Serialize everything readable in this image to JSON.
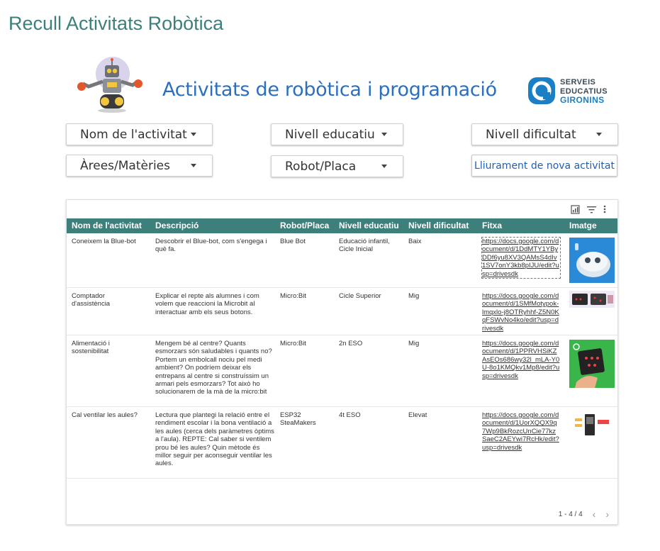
{
  "page": {
    "title": "Recull Activitats Robòtica"
  },
  "banner": {
    "title": "Activitats de robòtica i programació",
    "org_logo": {
      "line1": "SERVEIS",
      "line2": "EDUCATIUS",
      "line3": "GIRONINS",
      "color": "#1a7fc4"
    }
  },
  "filters": {
    "activity_name": "Nom de l'activitat",
    "educational_level": "Nivell educatiu",
    "difficulty_level": "Nivell dificultat",
    "subject_areas": "Àrees/Matèries",
    "robot_board": "Robot/Placa",
    "new_activity_button": "Lliurament de nova activitat"
  },
  "table": {
    "header_color": "#3d7f7a",
    "columns": [
      "Nom de l'activitat",
      "Descripció",
      "Robot/Placa",
      "Nivell educatiu",
      "Nivell dificultat",
      "Fitxa",
      "Imatge"
    ],
    "rows": [
      {
        "name": "Coneixem la Blue-bot",
        "description": "Descobrir el Blue-bot, com s'engega i què fa.",
        "robot": "Blue Bot",
        "level": "Educació infantil, Cicle Inicial",
        "difficulty": "Baix",
        "link": "https://docs.google.com/document/d/1DdMTY1YByDDf6yu8XV3QAMsS4dIv1SV7onY3kb8pIJU/edit?usp=drivesdk",
        "image_icon": "blue-bot-image"
      },
      {
        "name": "Comptador d'assistència",
        "description": "Explicar el repte als alumnes i com volem que reaccioni la Microbit al interactuar amb els seus botons.",
        "robot": "Micro:Bit",
        "level": "Cicle Superior",
        "difficulty": "Mig",
        "link": "https://docs.google.com/document/d/1SMfMotypok-lmqxlo-j8OTRyhhf-Z5N0KqFSWvNo4ko/edit?usp=drivesdk",
        "image_icon": "microbit-image"
      },
      {
        "name": "Alimentació i sostenibilitat",
        "description": "Mengem bé al centre? Quants esmorzars són saludables i quants no? Portem un embolcall nociu pel medi ambient? On podríem deixar els entrepans al centre si construíssim un armari pels esmorzars? Tot això ho solucionarem de la mà de la micro:bit",
        "robot": "Micro:Bit",
        "level": "2n ESO",
        "difficulty": "Mig",
        "link": "https://docs.google.com/document/d/1PPRVHSiKZAsEOs686wy32l_mLA-Y0U-8o1KMQkv1Mp8/edit?usp=drivesdk",
        "image_icon": "microbit-hand-image"
      },
      {
        "name": "Cal ventilar les aules?",
        "description": "Lectura que plantegi la relació entre el rendiment escolar i la bona ventilació a les aules (cerca dels paràmetres òptims a l'aula). REPTE: Cal saber si ventilem prou bé les aules? Quin mètode és millor seguir per aconseguir ventilar les aules.",
        "robot": "ESP32 SteaMakers",
        "level": "4t ESO",
        "difficulty": "Elevat",
        "link": "https://docs.google.com/document/d/1UorXQQX9q7Wp9BkRozcUnCie77kzSaeC2AEYwi7RcHk/edit?usp=drivesdk",
        "image_icon": "esp32-board-image"
      }
    ]
  },
  "pager": {
    "range": "1 - 4 / 4",
    "prev": "‹",
    "next": "›"
  }
}
